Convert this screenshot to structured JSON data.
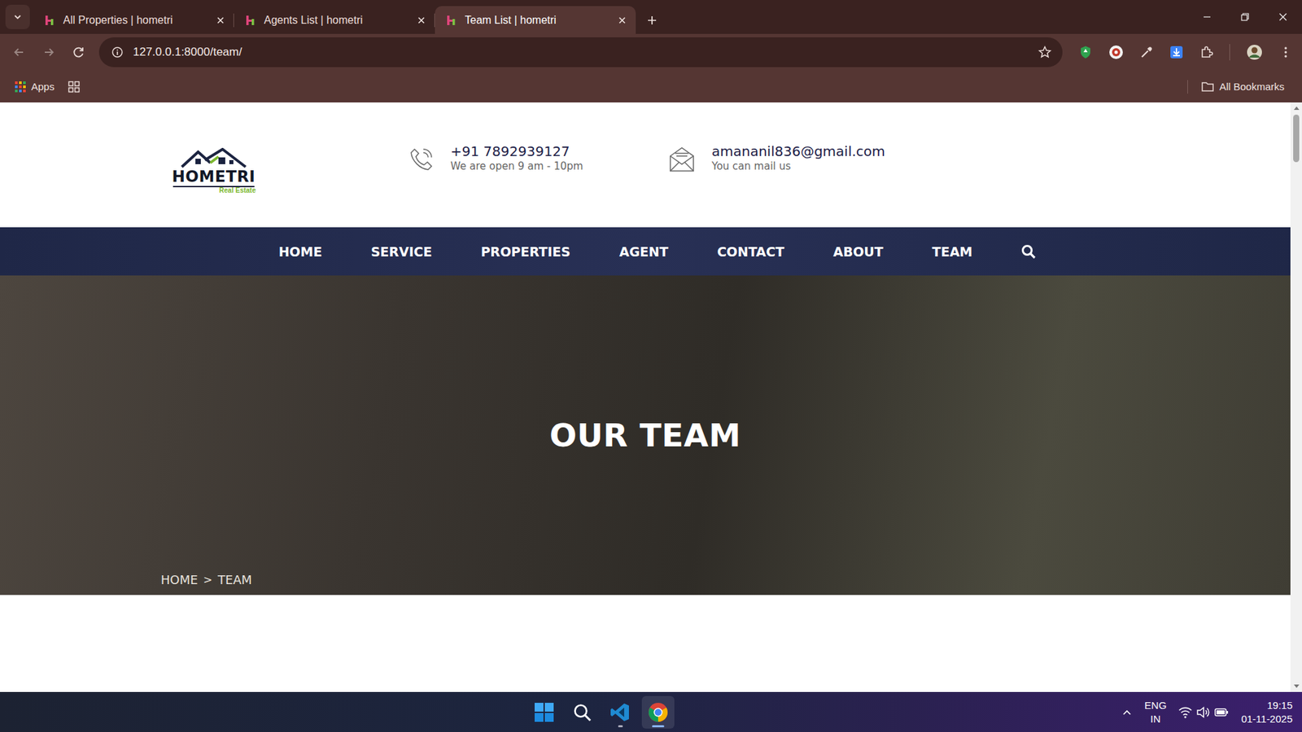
{
  "browser": {
    "tabs": [
      {
        "label": "All Properties | hometri",
        "selected": false
      },
      {
        "label": "Agents List | hometri",
        "selected": false
      },
      {
        "label": "Team List | hometri",
        "selected": true
      }
    ],
    "address": "127.0.0.1:8000/team/",
    "bookmarks": {
      "apps": "Apps",
      "all": "All Bookmarks"
    }
  },
  "site": {
    "logo": {
      "name": "HOMETRI",
      "tagline": "Real Estate"
    },
    "contacts": [
      {
        "kind": "phone",
        "value": "+91 7892939127",
        "note": "We are open 9 am - 10pm"
      },
      {
        "kind": "email",
        "value": "amananil836@gmail.com",
        "note": "You can mail us"
      }
    ],
    "nav": [
      "HOME",
      "SERVICE",
      "PROPERTIES",
      "AGENT",
      "CONTACT",
      "ABOUT",
      "TEAM"
    ],
    "hero": {
      "title": "OUR TEAM",
      "breadcrumb": [
        "HOME",
        "TEAM"
      ],
      "separator": ">"
    }
  },
  "taskbar": {
    "language": "ENG",
    "region": "IN",
    "time": "19:15",
    "date": "01-11-2025"
  }
}
